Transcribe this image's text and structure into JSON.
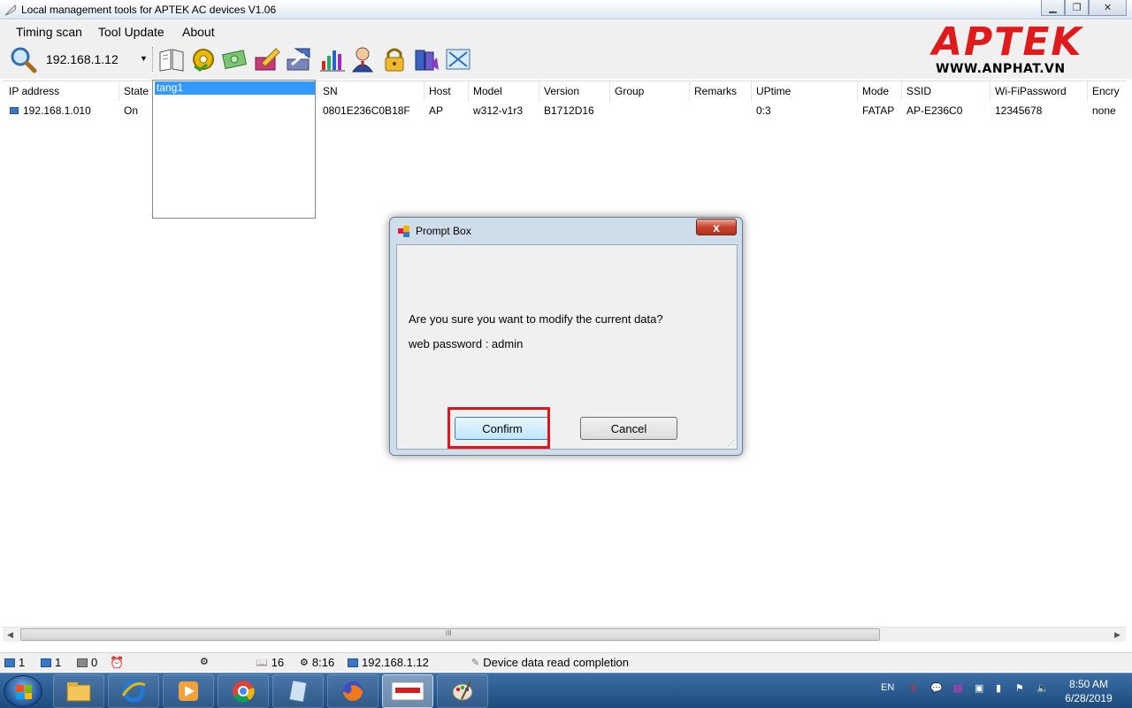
{
  "window": {
    "title": "Local management tools for APTEK AC devices  V1.06"
  },
  "menu": [
    "Timing scan",
    "Tool Update",
    "About"
  ],
  "toolbar": {
    "ip_value": "192.168.1.12",
    "icons": [
      "search-icon",
      "book-icon",
      "settings-gear-icon",
      "money-icon",
      "edit-icon",
      "upgrade-icon",
      "chart-icon",
      "user-icon",
      "lock-icon",
      "book-stack-icon",
      "network-tool-icon"
    ]
  },
  "logo": {
    "brand": "APTEK",
    "url": "WWW.ANPHAT.VN",
    "color": "#e01a1a"
  },
  "table": {
    "columns": [
      "IP address",
      "State",
      "",
      "SN",
      "Host",
      "Model",
      "Version",
      "Group",
      "Remarks",
      "UPtime",
      "Mode",
      "SSID",
      "Wi-FiPassword",
      "Encry"
    ],
    "rows": [
      {
        "ip": "192.168.1.010",
        "state": "On",
        "sn": "0801E236C0B18F",
        "host": "AP",
        "model": "w312-v1r3",
        "version": "B1712D16",
        "group": "",
        "remarks": "",
        "uptime": "0:3",
        "mode": "FATAP",
        "ssid": "AP-E236C0",
        "wifi_password": "12345678",
        "encry": "none"
      }
    ]
  },
  "group_dropdown": {
    "selected": "tang1"
  },
  "scrollbar": {
    "grip": "III"
  },
  "statusbar": {
    "online": "1",
    "selected": "1",
    "offline": "0",
    "count": "16",
    "time": "8:16",
    "ip": "192.168.1.12",
    "message": "Device data read completion"
  },
  "dialog": {
    "title": "Prompt Box",
    "line1": "Are you sure you want to modify the current data?",
    "line2": "web password : admin",
    "confirm": "Confirm",
    "cancel": "Cancel",
    "close": "x",
    "highlight_color": "#e3131b"
  },
  "taskbar": {
    "apps": [
      "file-explorer-icon",
      "internet-explorer-icon",
      "media-player-icon",
      "chrome-icon",
      "notes-icon",
      "firefox-icon",
      "aptek-tool-icon",
      "paint-icon"
    ],
    "language": "EN",
    "time": "8:50 AM",
    "date": "6/28/2019"
  }
}
